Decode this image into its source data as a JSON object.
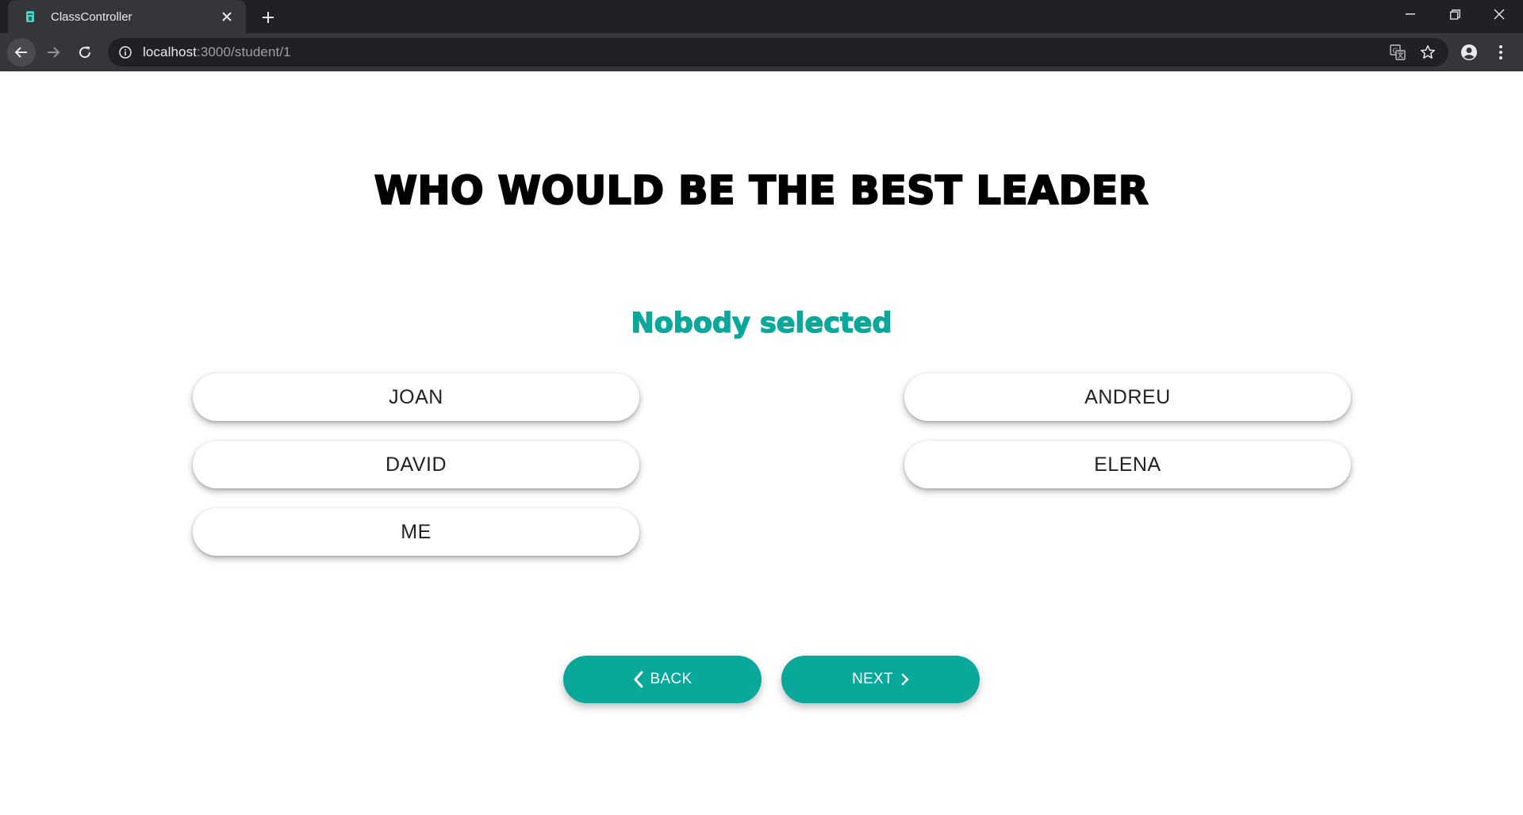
{
  "browser": {
    "tab_title": "ClassController",
    "url_host": "localhost",
    "url_path": ":3000/student/1",
    "icons": [
      "favicon-icon",
      "tab-close-icon",
      "new-tab-icon",
      "minimize-icon",
      "restore-icon",
      "close-window-icon",
      "back-icon",
      "forward-icon",
      "reload-icon",
      "info-icon",
      "translate-icon",
      "bookmark-star-icon",
      "profile-icon",
      "menu-icon"
    ]
  },
  "page": {
    "question": "WHO WOULD BE THE BEST LEADER",
    "selection_status": "Nobody selected",
    "options": [
      "JOAN",
      "ANDREU",
      "DAVID",
      "ELENA",
      "ME"
    ],
    "back_label": "BACK",
    "next_label": "NEXT"
  },
  "colors": {
    "accent": "#0aa89b",
    "chrome_dark": "#202124",
    "chrome_toolbar": "#35363a"
  }
}
